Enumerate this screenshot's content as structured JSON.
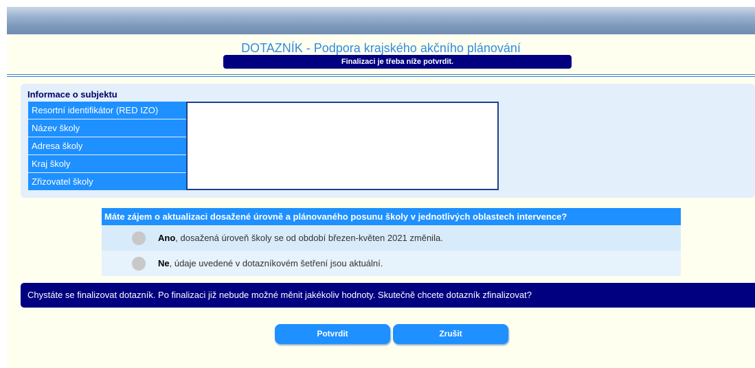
{
  "header": {
    "title": "DOTAZNÍK - Podpora krajského akčního plánování",
    "notice": "Finalizaci je třeba níže potvrdit."
  },
  "info": {
    "heading": "Informace o subjektu",
    "fields": [
      {
        "label": "Resortní identifikátor (RED IZO)",
        "value": ""
      },
      {
        "label": "Název školy",
        "value": ""
      },
      {
        "label": "Adresa školy",
        "value": ""
      },
      {
        "label": "Kraj školy",
        "value": ""
      },
      {
        "label": "Zřizovatel školy",
        "value": ""
      }
    ]
  },
  "question": {
    "text": "Máte zájem o aktualizaci dosažené úrovně a plánovaného posunu školy v jednotlivých oblastech intervence?",
    "options": [
      {
        "bold": "Ano",
        "text": ", dosažená úroveň školy se od období březen-květen 2021 změnila.",
        "selected": false
      },
      {
        "bold": "Ne",
        "text": ", údaje uvedené v dotazníkovém šetření jsou aktuální.",
        "selected": false
      }
    ]
  },
  "warning": "Chystáte se finalizovat dotazník. Po finalizaci již nebude možné měnit jakékoliv hodnoty. Skutečně chcete dotazník zfinalizovat?",
  "buttons": {
    "confirm": "Potvrdit",
    "cancel": "Zrušit"
  },
  "colors": {
    "primary": "#1e90ff",
    "navy": "#000080",
    "background": "#fffff0",
    "title": "#2f8be0"
  }
}
